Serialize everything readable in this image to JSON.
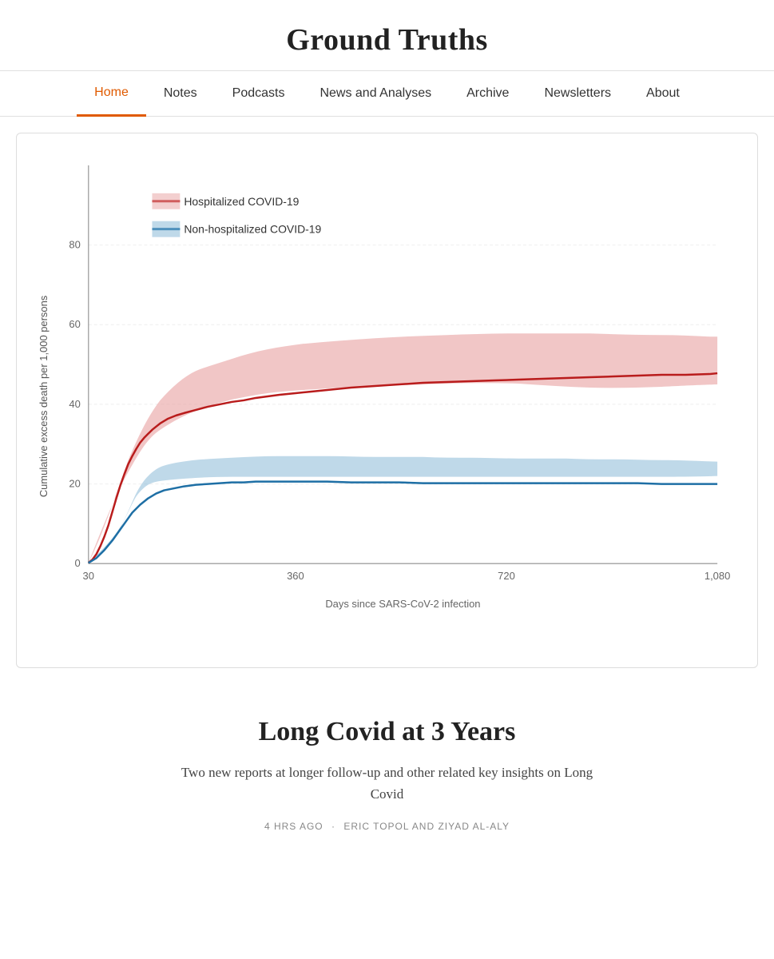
{
  "header": {
    "title": "Ground Truths"
  },
  "nav": {
    "items": [
      {
        "label": "Home",
        "active": true
      },
      {
        "label": "Notes",
        "active": false
      },
      {
        "label": "Podcasts",
        "active": false
      },
      {
        "label": "News and Analyses",
        "active": false
      },
      {
        "label": "Archive",
        "active": false
      },
      {
        "label": "Newsletters",
        "active": false
      },
      {
        "label": "About",
        "active": false
      }
    ]
  },
  "chart": {
    "y_label": "Cumulative excess death per 1,000 persons",
    "x_label": "Days since SARS-CoV-2 infection",
    "x_ticks": [
      "30",
      "360",
      "720",
      "1,080"
    ],
    "y_ticks": [
      "0",
      "20",
      "40",
      "60",
      "80"
    ],
    "legend": [
      {
        "label": "Hospitalized COVID-19",
        "color": "#c0392b"
      },
      {
        "label": "Non-hospitalized COVID-19",
        "color": "#2980b9"
      }
    ]
  },
  "article": {
    "title": "Long Covid at 3 Years",
    "subtitle": "Two new reports at longer follow-up and other related key insights on Long Covid",
    "meta_time": "4 HRS AGO",
    "meta_dot": "·",
    "meta_authors": "ERIC TOPOL AND ZIYAD AL-ALY"
  }
}
